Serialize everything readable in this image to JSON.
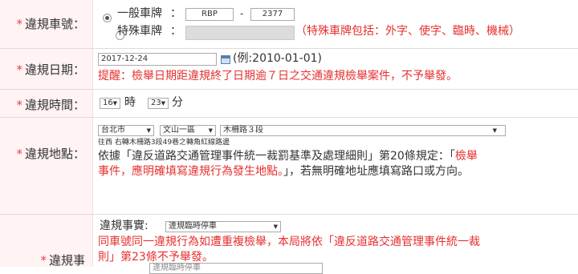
{
  "plate": {
    "label": "違規車號",
    "option_general": "一般車牌",
    "plate_prefix": "RBP",
    "dash": "-",
    "plate_number": "2377",
    "option_special": "特殊車牌",
    "special_note": "（特殊車牌包括：外字、使字、臨時、機械）"
  },
  "date": {
    "label": "違規日期",
    "value": "2017-12-24",
    "example": "(例:2010-01-01)",
    "reminder": "提醒：檢舉日期距違規終了日期逾７日之交通違規檢舉案件，不予舉發。"
  },
  "time": {
    "label": "違規時間",
    "hour": "16",
    "hour_unit": "時",
    "minute": "23",
    "minute_unit": "分"
  },
  "location": {
    "label": "違規地點",
    "city": "台北市",
    "district": "文山一區",
    "road": "木柵路３段",
    "address_text": "往西 右轉木柵路3段49巷之轉角紅線路邊",
    "note_black_1": "依據「違反道路交通管理事件統一裁罰基準及處理細則」第20條規定：「",
    "note_red_1": "檢舉",
    "note_red_2": "事件，應明確填寫違規行為發生地點。",
    "note_black_2": "」，若無明確地址應填寫路口或方向。"
  },
  "fact": {
    "label": "違規事",
    "field_label": "違規事實:",
    "value": "違規臨時停車",
    "warning_1": "同車號同一違規行為如遭重複檢舉，本局將依「違反道路交通管理事件統一裁",
    "warning_2": "則」第23條不予舉發。",
    "next_select": "違規臨時停車"
  },
  "colors": {
    "label_bg": "#fff3f3",
    "required_star": "#e0434f",
    "warning_red": "#e6302f"
  }
}
